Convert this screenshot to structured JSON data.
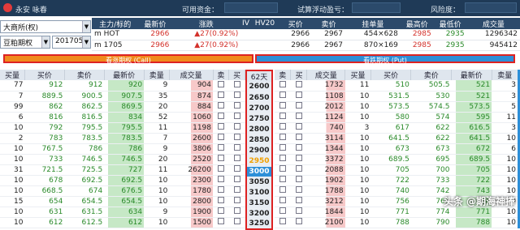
{
  "topbar": {
    "app": "永安 咏春",
    "funds_label": "可用资金：",
    "trial_label": "试算浮动盈亏：",
    "risk_label": "风险度："
  },
  "left": {
    "exchange": "大商所(权)",
    "product": "豆粕期权",
    "month": "201705"
  },
  "quote": {
    "headers": [
      "主力/标的",
      "最新价",
      "涨跌",
      "IV",
      "HV20",
      "买价",
      "卖价",
      "挂单量",
      "最高价",
      "最低价",
      "成交量"
    ],
    "rows": [
      [
        "m HOT",
        "2966",
        "▲27(0.92%)",
        "",
        "",
        "2966",
        "2967",
        "454×628",
        "2985",
        "2935",
        "1296342"
      ],
      [
        "m 1705",
        "2966",
        "▲27(0.92%)",
        "",
        "",
        "2966",
        "2967",
        "870×169",
        "2985",
        "2935",
        "945412"
      ]
    ]
  },
  "bars": {
    "call": "看涨期权 (Call)",
    "put": "看跌期权 (Put)"
  },
  "call_headers": [
    "买量",
    "买价",
    "卖价",
    "最新价",
    "卖量",
    "成交量",
    "卖",
    "买"
  ],
  "strike_header": "62天",
  "put_headers": [
    "卖",
    "买",
    "成交量",
    "买量",
    "买价",
    "卖价",
    "最新价",
    "卖量"
  ],
  "strikes": [
    "2600",
    "2650",
    "2700",
    "2750",
    "2800",
    "2850",
    "2900",
    "2950",
    "3000",
    "3050",
    "3100",
    "3150",
    "3200",
    "3250"
  ],
  "calls": [
    [
      "77",
      "912",
      "912",
      "920",
      "9",
      "904"
    ],
    [
      "7",
      "889.5",
      "900.5",
      "907.5",
      "35",
      "874"
    ],
    [
      "99",
      "862",
      "862.5",
      "869.5",
      "20",
      "884"
    ],
    [
      "6",
      "816",
      "816.5",
      "834",
      "52",
      "1060"
    ],
    [
      "10",
      "792",
      "795.5",
      "795.5",
      "11",
      "1198"
    ],
    [
      "2",
      "783",
      "783.5",
      "783.5",
      "7",
      "2600"
    ],
    [
      "10",
      "767.5",
      "786",
      "786",
      "9",
      "3806"
    ],
    [
      "10",
      "733",
      "746.5",
      "746.5",
      "20",
      "2520"
    ],
    [
      "31",
      "721.5",
      "725.5",
      "727",
      "11",
      "26200"
    ],
    [
      "10",
      "678",
      "692.5",
      "692.5",
      "10",
      "2300"
    ],
    [
      "10",
      "668.5",
      "674",
      "676.5",
      "10",
      "1780"
    ],
    [
      "15",
      "654",
      "654.5",
      "654.5",
      "10",
      "2800"
    ],
    [
      "10",
      "631",
      "631.5",
      "634",
      "9",
      "1900"
    ],
    [
      "10",
      "612",
      "612.5",
      "612",
      "10",
      "1500"
    ]
  ],
  "puts": [
    [
      "1732",
      "11",
      "510",
      "505.5",
      "521",
      "3"
    ],
    [
      "1108",
      "10",
      "531.5",
      "530",
      "521",
      "3"
    ],
    [
      "2012",
      "10",
      "573.5",
      "574.5",
      "573.5",
      "5"
    ],
    [
      "1124",
      "10",
      "580",
      "574",
      "595",
      "11"
    ],
    [
      "740",
      "3",
      "617",
      "622",
      "616.5",
      "3"
    ],
    [
      "3114",
      "10",
      "641.5",
      "622",
      "641.5",
      "10"
    ],
    [
      "1344",
      "10",
      "673",
      "673",
      "672",
      "6"
    ],
    [
      "3372",
      "10",
      "689.5",
      "695",
      "689.5",
      "10"
    ],
    [
      "2088",
      "10",
      "705",
      "700",
      "705",
      "10"
    ],
    [
      "1902",
      "10",
      "722",
      "733",
      "722",
      "10"
    ],
    [
      "1788",
      "10",
      "740",
      "742",
      "743",
      "10"
    ],
    [
      "3212",
      "10",
      "756",
      "760",
      "756",
      "10"
    ],
    [
      "1844",
      "10",
      "771",
      "774",
      "771",
      "10"
    ],
    [
      "2100",
      "10",
      "788",
      "790",
      "788",
      "10"
    ]
  ],
  "watermark": "头条 @期海神捧"
}
